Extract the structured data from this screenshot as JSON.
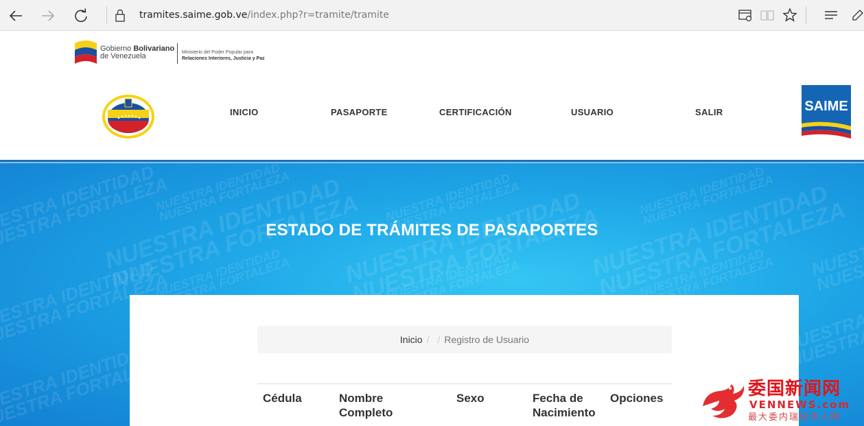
{
  "browser": {
    "url_host": "tramites.saime.gob.ve",
    "url_path": "/index.php?r=tramite/tramite"
  },
  "header": {
    "gov_line1_prefix": "Gobierno ",
    "gov_line1_bold": "Bolivariano",
    "gov_line2": "de Venezuela",
    "ministry_line1": "Ministerio del Poder Popular para",
    "ministry_line2": "Relaciones Interiores, Justicia y Paz",
    "saime_logo_text": "SAIME",
    "menu": [
      "INICIO",
      "PASAPORTE",
      "CERTIFICACIÓN",
      "USUARIO",
      "SALIR"
    ]
  },
  "banner": {
    "title": "ESTADO DE TRÁMITES DE PASAPORTES",
    "watermark_line1": "NUESTRA IDENTIDAD",
    "watermark_line2": "NUESTRA FORTALEZA"
  },
  "breadcrumb": {
    "home": "Inicio",
    "separator": "/",
    "active": "Registro de Usuario"
  },
  "table": {
    "headers": [
      [
        "Cédula"
      ],
      [
        "Nombre",
        "Completo"
      ],
      [
        "Sexo"
      ],
      [
        "Fecha de",
        "Nacimiento"
      ],
      [
        "Opciones"
      ]
    ]
  },
  "overlay": {
    "cn_title": "委国新闻网",
    "en_title": "VENNEWS.com",
    "cn_sub": "最大委内瑞拉华人网"
  },
  "colors": {
    "header_line": "#1b6fb8",
    "banner_blue": "#1da4e6",
    "overlay_red": "#e0161b"
  }
}
